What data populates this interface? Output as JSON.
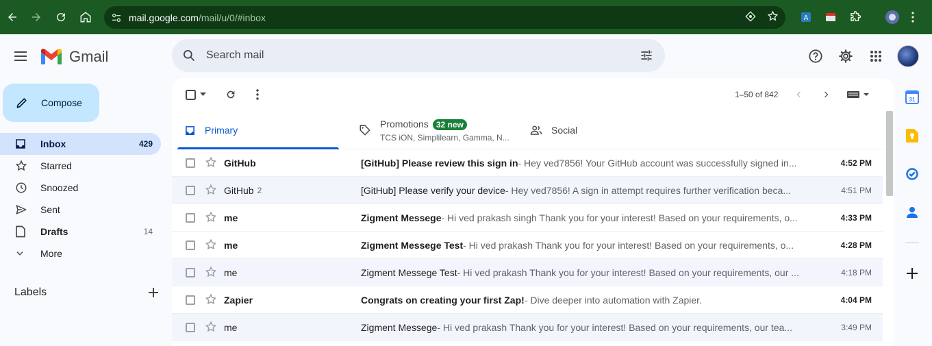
{
  "browser": {
    "url_host": "mail.google.com",
    "url_path": "/mail/u/0/#inbox"
  },
  "app": {
    "name": "Gmail"
  },
  "search": {
    "placeholder": "Search mail"
  },
  "compose": {
    "label": "Compose"
  },
  "sidebar": {
    "items": [
      {
        "label": "Inbox",
        "count": "429",
        "icon": "inbox-icon",
        "active": true
      },
      {
        "label": "Starred",
        "count": "",
        "icon": "star-icon"
      },
      {
        "label": "Snoozed",
        "count": "",
        "icon": "clock-icon"
      },
      {
        "label": "Sent",
        "count": "",
        "icon": "send-icon"
      },
      {
        "label": "Drafts",
        "count": "14",
        "icon": "draft-icon"
      },
      {
        "label": "More",
        "count": "",
        "icon": "chevron-down-icon"
      }
    ],
    "labels_heading": "Labels"
  },
  "toolbar": {
    "pagination": "1–50 of 842"
  },
  "tabs": {
    "primary": {
      "label": "Primary"
    },
    "promotions": {
      "label": "Promotions",
      "badge": "32 new",
      "subtitle": "TCS iON, Simplilearn, Gamma, N..."
    },
    "social": {
      "label": "Social"
    }
  },
  "emails": [
    {
      "sender": "GitHub",
      "thread_count": "",
      "subject": "[GitHub] Please review this sign in",
      "snippet": " - Hey ved7856! Your GitHub account was successfully signed in...",
      "time": "4:52 PM",
      "unread": true
    },
    {
      "sender": "GitHub",
      "thread_count": "2",
      "subject": "[GitHub] Please verify your device",
      "snippet": " - Hey ved7856! A sign in attempt requires further verification beca...",
      "time": "4:51 PM",
      "unread": false
    },
    {
      "sender": "me",
      "thread_count": "",
      "subject": "Zigment Messege",
      "snippet": " - Hi ved prakash singh Thank you for your interest! Based on your requirements, o...",
      "time": "4:33 PM",
      "unread": true
    },
    {
      "sender": "me",
      "thread_count": "",
      "subject": "Zigment Messege Test",
      "snippet": " - Hi ved prakash Thank you for your interest! Based on your requirements, o...",
      "time": "4:28 PM",
      "unread": true
    },
    {
      "sender": "me",
      "thread_count": "",
      "subject": "Zigment Messege Test",
      "snippet": " - Hi ved prakash Thank you for your interest! Based on your requirements, our ...",
      "time": "4:18 PM",
      "unread": false
    },
    {
      "sender": "Zapier",
      "thread_count": "",
      "subject": "Congrats on creating your first Zap!",
      "snippet": " - Dive deeper into automation with Zapier.",
      "time": "4:04 PM",
      "unread": true
    },
    {
      "sender": "me",
      "thread_count": "",
      "subject": "Zigment Messege",
      "snippet": " - Hi ved prakash Thank you for your interest! Based on your requirements, our tea...",
      "time": "3:49 PM",
      "unread": false
    }
  ],
  "colors": {
    "browser_frame": "#1c5a23",
    "accent_blue": "#0b57d0",
    "compose_bg": "#c2e7ff",
    "active_nav_bg": "#d3e3fd",
    "badge_green": "#188038"
  },
  "side_panel": {
    "calendar_day": "31"
  }
}
